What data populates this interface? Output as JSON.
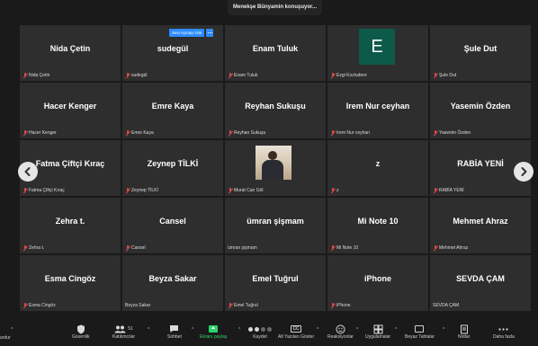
{
  "speaking_indicator": "Menekşe Bünyamin konuşuyor...",
  "unmute_button": "Sesi Açmayı İste",
  "tiles": [
    {
      "name": "Nida Çetin",
      "label": "Nida Çetin",
      "muted": true
    },
    {
      "name": "sudegül",
      "label": "sudegül",
      "muted": true
    },
    {
      "name": "Enam Tuluk",
      "label": "Enam Tuluk",
      "muted": true
    },
    {
      "avatar": "E",
      "label": "Ezgi Kozludere",
      "muted": true
    },
    {
      "name": "Şule Dut",
      "label": "Şule Dut",
      "muted": true
    },
    {
      "name": "Hacer Kenger",
      "label": "Hacer Kenger",
      "muted": true
    },
    {
      "name": "Emre Kaya",
      "label": "Emre Kaya",
      "muted": true
    },
    {
      "name": "Reyhan Sukuşu",
      "label": "Reyhan Sukuşu",
      "muted": true
    },
    {
      "name": "Irem Nur ceyhan",
      "label": "Irem Nur ceyhan",
      "muted": true
    },
    {
      "name": "Yasemin Özden",
      "label": "Yasemin Özden",
      "muted": true
    },
    {
      "name": "Fatma Çiftçi Kıraç",
      "label": "Fatma Çiftçi Kıraç",
      "muted": true
    },
    {
      "name": "Zeynep TİLKİ",
      "label": "Zeynep TİLKİ",
      "muted": true
    },
    {
      "photo": true,
      "label": "Murat Can Göl",
      "muted": true
    },
    {
      "name": "z",
      "label": "z",
      "muted": true
    },
    {
      "name": "RABİA YENİ",
      "label": "RABİA YENİ",
      "muted": true
    },
    {
      "name": "Zehra t.",
      "label": "Zehra t.",
      "muted": true
    },
    {
      "name": "Cansel",
      "label": "Cansel",
      "muted": true
    },
    {
      "name": "ümran şişmam",
      "label": "ümran şişmam",
      "muted": false
    },
    {
      "name": "Mi Note 10",
      "label": "Mi Note 10",
      "muted": true
    },
    {
      "name": "Mehmet Ahraz",
      "label": "Mehmet Ahraz",
      "muted": true
    },
    {
      "name": "Esma Cingöz",
      "label": "Esma Cingöz",
      "muted": true
    },
    {
      "name": "Beyza Sakar",
      "label": "Beyza Sakar",
      "muted": false
    },
    {
      "name": "Emel Tuğrul",
      "label": "Emel Tuğrul",
      "muted": true
    },
    {
      "name": "iPhone",
      "label": "iPhone",
      "muted": true
    },
    {
      "name": "SEVDA ÇAM",
      "label": "SEVDA ÇAM",
      "muted": false
    }
  ],
  "toolbar": {
    "partial_left": "ardur",
    "security": "Güvenlik",
    "participants": "Katılımcılar",
    "participants_count": "51",
    "chat": "Sohbet",
    "share_screen": "Ekranı paylaş",
    "record": "Kaydet",
    "captions": "Alt Yazıları Göster",
    "reactions": "Reaksiyonlar",
    "apps": "Uygulamalar",
    "whiteboards": "Beyaz Tahtalar",
    "notes": "Notlar",
    "more": "Daha fazla"
  },
  "colors": {
    "tile_bg": "#2e2e2e",
    "app_bg": "#1a1a1a",
    "muted_red": "#e04848",
    "accent_blue": "#2d8cff",
    "share_green": "#2bd46a",
    "avatar_green": "#0e5a4a"
  }
}
